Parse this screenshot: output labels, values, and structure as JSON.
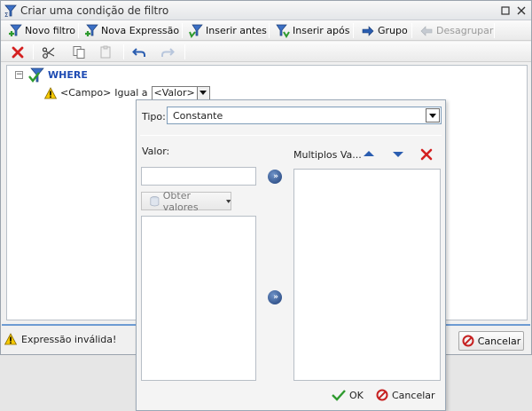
{
  "window": {
    "title": "Criar uma condição de filtro"
  },
  "toolbar": {
    "novo_filtro": "Novo filtro",
    "nova_expressao": "Nova Expressão",
    "inserir_antes": "Inserir antes",
    "inserir_apos": "Inserir após",
    "grupo": "Grupo",
    "desagrupar": "Desagrupar"
  },
  "tree": {
    "root_label": "WHERE",
    "condition": {
      "field": "<Campo>",
      "operator": "Igual a",
      "value": "<Valor>"
    }
  },
  "status": {
    "message": "Expressão inválida!",
    "cancel_label": "Cancelar"
  },
  "popup": {
    "tipo_label": "Tipo:",
    "tipo_value": "Constante",
    "valor_label": "Valor:",
    "valor_input": "",
    "obter_valores": "Obter valores",
    "multiplos_label": "Multiplos Va...",
    "ok_label": "OK",
    "cancel_label": "Cancelar"
  },
  "icons": {
    "window": "sigma-filter-icon",
    "warning": "warning-icon",
    "delete": "red-x-icon"
  },
  "colors": {
    "where_label": "#1e4bb3",
    "accent_bar": "#6d9bd3",
    "delete_red": "#d42020",
    "ok_green": "#2e9a2e"
  }
}
